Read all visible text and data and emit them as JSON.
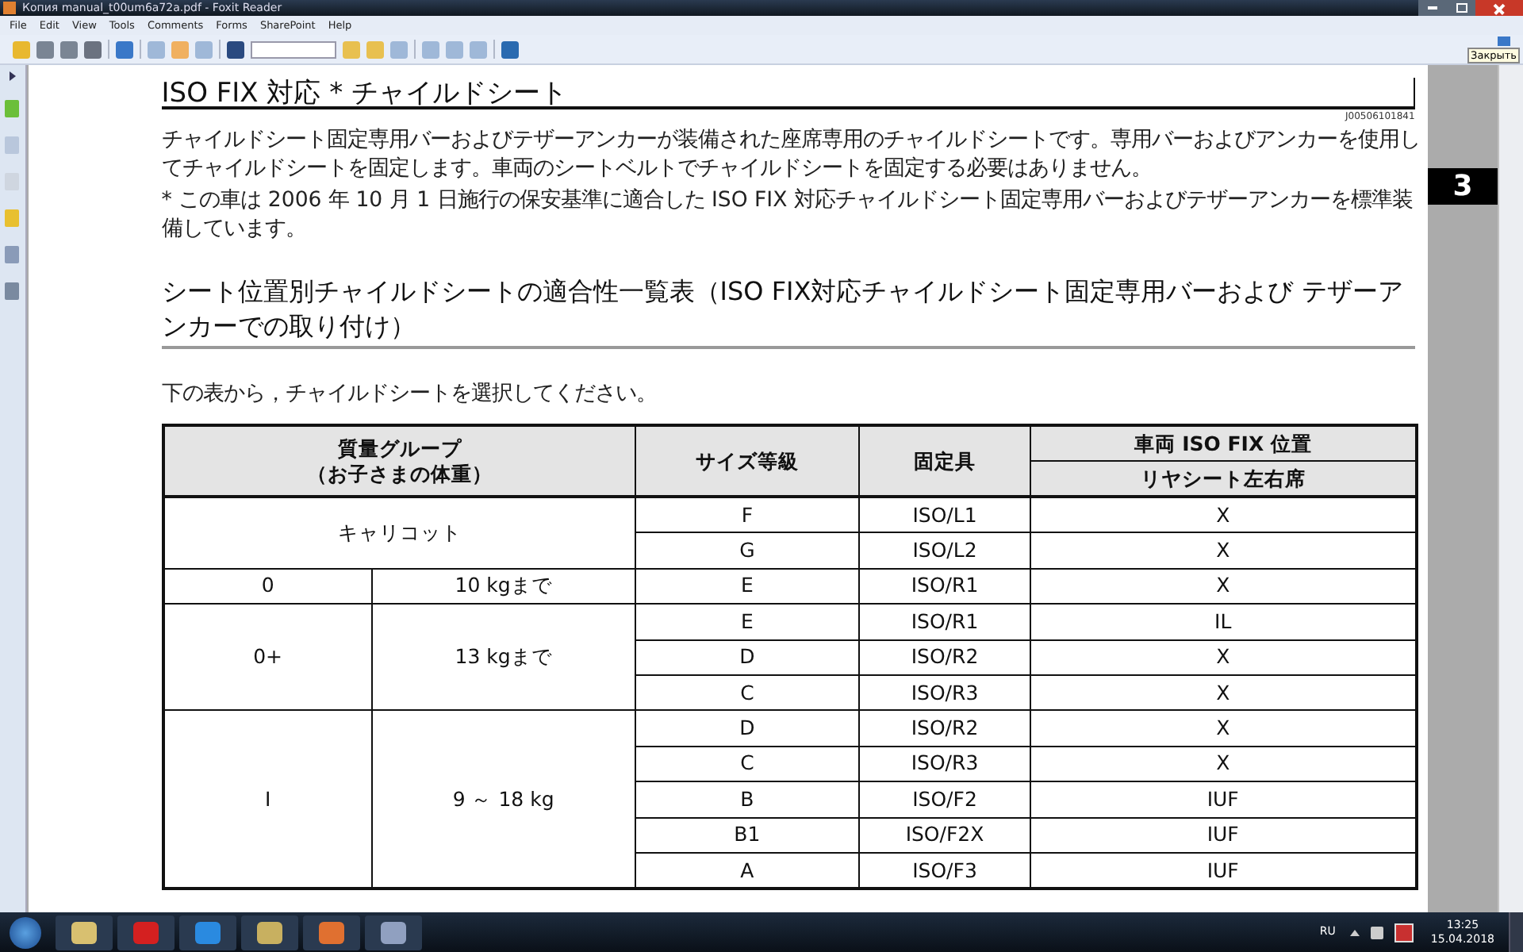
{
  "window": {
    "title": "Копия manual_t00um6a72a.pdf - Foxit Reader"
  },
  "menu": [
    "File",
    "Edit",
    "View",
    "Tools",
    "Comments",
    "Forms",
    "SharePoint",
    "Help"
  ],
  "tooltip": "Закрыть",
  "chapter_tab": "3",
  "page": {
    "heading": "ISO FIX 対応 * チャイルドシート",
    "code": "J00506101841",
    "paragraphs": [
      "チャイルドシート固定専用バーおよびテザーアンカーが装備された座席専用のチャイルドシートです。専用バーおよびアンカーを使用してチャイルドシートを固定します。車両のシートベルトでチャイルドシートを固定する必要はありません。",
      "* この車は 2006 年 10 月 1 日施行の保安基準に適合した ISO FIX 対応チャイルドシート固定専用バーおよびテザーアンカーを標準装備しています。"
    ],
    "subheading": "シート位置別チャイルドシートの適合性一覧表（ISO FIX対応チャイルドシート固定専用バーおよび テザーアンカーでの取り付け）",
    "instruction": "下の表から，チャイルドシートを選択してください。",
    "table": {
      "columns": [
        [
          "質量グループ",
          "（お子さまの体重）"
        ],
        "サイズ等級",
        "固定具",
        "車両 ISO FIX 位置"
      ],
      "subcolumn": "リヤシート左右席",
      "groups": [
        {
          "kind": "merged",
          "group": "キャリコット",
          "rows": [
            [
              "F",
              "ISO/L1",
              "X"
            ],
            [
              "G",
              "ISO/L2",
              "X"
            ]
          ]
        },
        {
          "kind": "split",
          "group": "0",
          "weight": "10 kgまで",
          "rows": [
            [
              "E",
              "ISO/R1",
              "X"
            ]
          ]
        },
        {
          "kind": "split",
          "group": "0+",
          "weight": "13 kgまで",
          "rows": [
            [
              "E",
              "ISO/R1",
              "IL"
            ],
            [
              "D",
              "ISO/R2",
              "X"
            ],
            [
              "C",
              "ISO/R3",
              "X"
            ]
          ]
        },
        {
          "kind": "split",
          "group": "I",
          "weight": "9 ～ 18 kg",
          "rows": [
            [
              "D",
              "ISO/R2",
              "X"
            ],
            [
              "C",
              "ISO/R3",
              "X"
            ],
            [
              "B",
              "ISO/F2",
              "IUF"
            ],
            [
              "B1",
              "ISO/F2X",
              "IUF"
            ],
            [
              "A",
              "ISO/F3",
              "IUF"
            ]
          ]
        }
      ]
    }
  },
  "tray": {
    "language": "RU",
    "time": "13:25",
    "date": "15.04.2018"
  }
}
